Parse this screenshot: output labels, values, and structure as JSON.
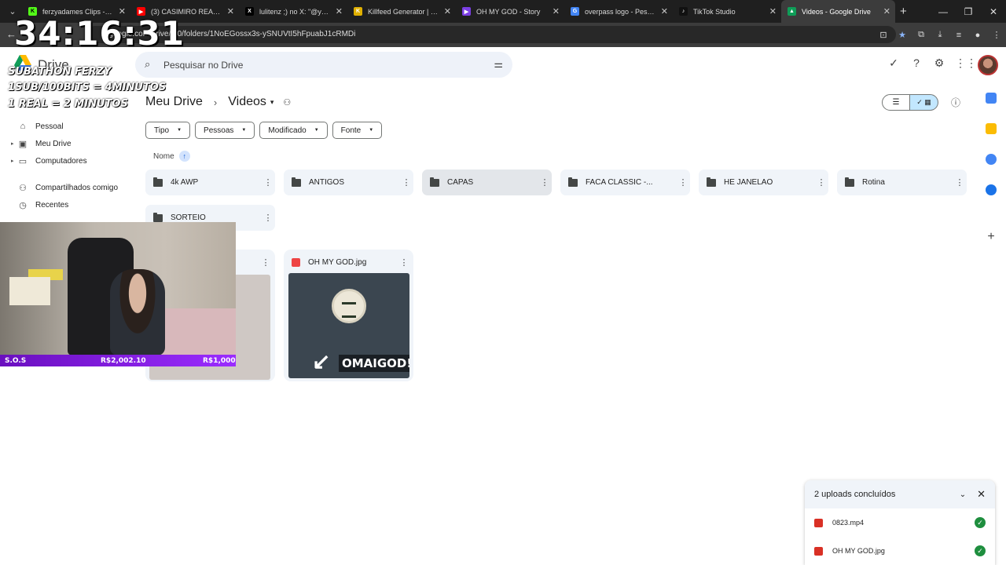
{
  "browser": {
    "tabs": [
      {
        "title": "ferzyadames Clips - Watc",
        "color": "#53fc18",
        "glyph": "K"
      },
      {
        "title": "(3) CASIMIRO REAGE: PES",
        "color": "#ff0000",
        "glyph": "▶"
      },
      {
        "title": "lulitenz ;) no X: \"@yunghe",
        "color": "#000000",
        "glyph": "X"
      },
      {
        "title": "Killfeed Generator | Bind",
        "color": "#e0b000",
        "glyph": "K"
      },
      {
        "title": "OH MY GOD - Story",
        "color": "#7b3fe4",
        "glyph": "▶"
      },
      {
        "title": "overpass logo - Pesquisa",
        "color": "#4285f4",
        "glyph": "G"
      },
      {
        "title": "TikTok Studio",
        "color": "#111111",
        "glyph": "♪"
      },
      {
        "title": "Videos - Google Drive",
        "color": "#0f9d58",
        "glyph": "▲"
      }
    ],
    "url": "drive.google.com/drive/u/0/folders/1NoEGossx3s-ySNUVtI5hFpuabJ1cRMDi",
    "url_visible": "e.google.com/drive/u/0/folders/1NoEGossx3s-ySNUVtI5hFpuabJ1cRMDi"
  },
  "drive": {
    "logo_text": "Drive",
    "search_placeholder": "Pesquisar no Drive",
    "breadcrumb_root": "Meu Drive",
    "breadcrumb_current": "Videos",
    "filters": [
      "Tipo",
      "Pessoas",
      "Modificado",
      "Fonte"
    ],
    "sort_label": "Nome",
    "sidebar": [
      {
        "label": "Pessoal",
        "icon": "home-icon"
      },
      {
        "label": "Meu Drive",
        "icon": "drive-icon"
      },
      {
        "label": "Computadores",
        "icon": "computer-icon"
      },
      {
        "label": "Compartilhados comigo",
        "icon": "people-icon"
      },
      {
        "label": "Recentes",
        "icon": "clock-icon"
      }
    ],
    "folders": [
      "4k AWP",
      "ANTIGOS",
      "CAPAS",
      "FACA CLASSIC -...",
      "HE JANELAO",
      "Rotina",
      "SORTEIO"
    ],
    "files": [
      {
        "name": "OH MY GOD.jpg",
        "thumb_text": "OMAIGOD!!"
      }
    ]
  },
  "uploads": {
    "title": "2 uploads concluídos",
    "items": [
      "0823.mp4",
      "OH MY GOD.jpg"
    ]
  },
  "stream_overlay": {
    "timer": "34:16:31",
    "line1": "SUBATHON FERZY",
    "line2": "1SUB/100BITS = 4MINUTOS",
    "line3": "1 REAL = 2 MINUTOS",
    "sos_label": "S.O.S",
    "amount1": "R$2,002.10",
    "amount2": "R$1,000"
  },
  "colors": {
    "accent": "#0b57d0",
    "selected_view": "#c2e7ff",
    "success": "#1e8e3e",
    "sos_bar": "#9b2cff"
  }
}
